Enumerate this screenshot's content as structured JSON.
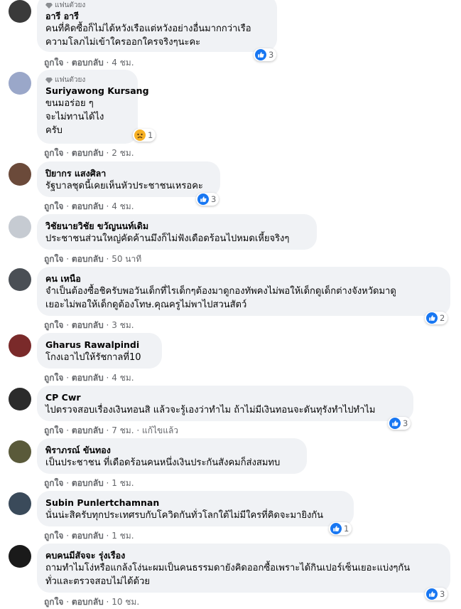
{
  "labels": {
    "like": "ถูกใจ",
    "reply": "ตอบกลับ",
    "edited": "แก้ไขแล้ว",
    "fan_badge": "แฟนตัวยง",
    "sep": " · "
  },
  "colors": {
    "like": "#1877f2",
    "sad": "#f7b125",
    "bubble": "#f0f2f5",
    "meta": "#65676b"
  },
  "comments": [
    {
      "badge": "แฟนตัวยง",
      "author": "อารี อารี",
      "text": "คนที่คิดซื้อก็ไม่ได้หวังเรือแต่หวังอย่างอื่นมากกว่าเรือ\nความโลภไม่เข้าใครออกใครจริงๆนะคะ",
      "time": "4 ชม.",
      "reaction": {
        "icon": "like-icon",
        "count": "3"
      }
    },
    {
      "badge": "แฟนตัวยง",
      "author": "Suriyawong Kursang",
      "text": "ขนมอร่อย ๆ\nจะไม่ทานได้ไง\nครับ",
      "time": "2 ชม.",
      "reaction": {
        "icon": "sad-icon",
        "count": "1"
      }
    },
    {
      "author": "ปิยากร แสงศิลา",
      "text": "รัฐบาลชุดนี้เคยเห็นหัวประชาชนเหรอคะ",
      "time": "4 ชม.",
      "reaction": {
        "icon": "like-icon",
        "count": "3"
      }
    },
    {
      "author": "วิชัยนายวิชัย ขวัญนนท์เดิม",
      "text": "ประชาชนส่วนใหญ่คัดค้านมึงก็ไม่ฟังเดือดร้อนไปหมดเหี้ยจริงๆ",
      "time": "50 นาที"
    },
    {
      "author": "คน เหนือ",
      "text": "จำเป็นต้องซื้อชิครับพอวันเด็กที่ไรเด็กๆต้องมาดูกองทัพคงไม่พอให้เด็กดูเด็กต่างจังหวัดมาดู\nเยอะไม่พอให้เด็กดูต้องโทษ.คุณครูไม่พาไปสวนสัตว์",
      "time": "3 ชม.",
      "reaction": {
        "icon": "like-icon",
        "count": "2"
      }
    },
    {
      "author": "Gharus Rawalpindi",
      "text": "โกงเอาไปให้รัชกาลที่10",
      "time": "4 ชม."
    },
    {
      "author": "CP Cwr",
      "text": "ไปตรวจสอบเรื่องเงินทอนสิ แล้วจะรู้เองว่าทำไม ถ้าไม่มีเงินทอนจะดันทุรังทำไปทำไม",
      "time": "7 ชม.",
      "edited": true,
      "reaction": {
        "icon": "like-icon",
        "count": "3"
      }
    },
    {
      "author": "พิราภรณ์ ขันทอง",
      "text": "เป็นประชาชน ที่เดือดร้อนคนหนึ่งเงินประกันสังคมก็ส่งสมทบ",
      "time": "1 ชม."
    },
    {
      "author": "Subin Punlertchamnan",
      "text": "นั่นน่ะสิครับทุกประเทศรบกับโควิดกันทั่วโลกใต้ไม่มีใครที่คิดจะมายิงกัน",
      "time": "1 ชม.",
      "reaction": {
        "icon": "like-icon",
        "count": "1"
      }
    },
    {
      "author": "คบคนมีสัจจะ รุ่งเรือง",
      "text": "ถามทำไมโง่หรือแกล้งโง่นะผมเป็นคนธรรมดายังคิดออกซื้อเพราะได้กินเปอร์เซ็นเยอะแบ่งๆกัน\nทั่วและตรวจสอบไม่ได้ด้วย",
      "time": "10 ชม.",
      "reaction": {
        "icon": "like-icon",
        "count": "3"
      }
    }
  ]
}
